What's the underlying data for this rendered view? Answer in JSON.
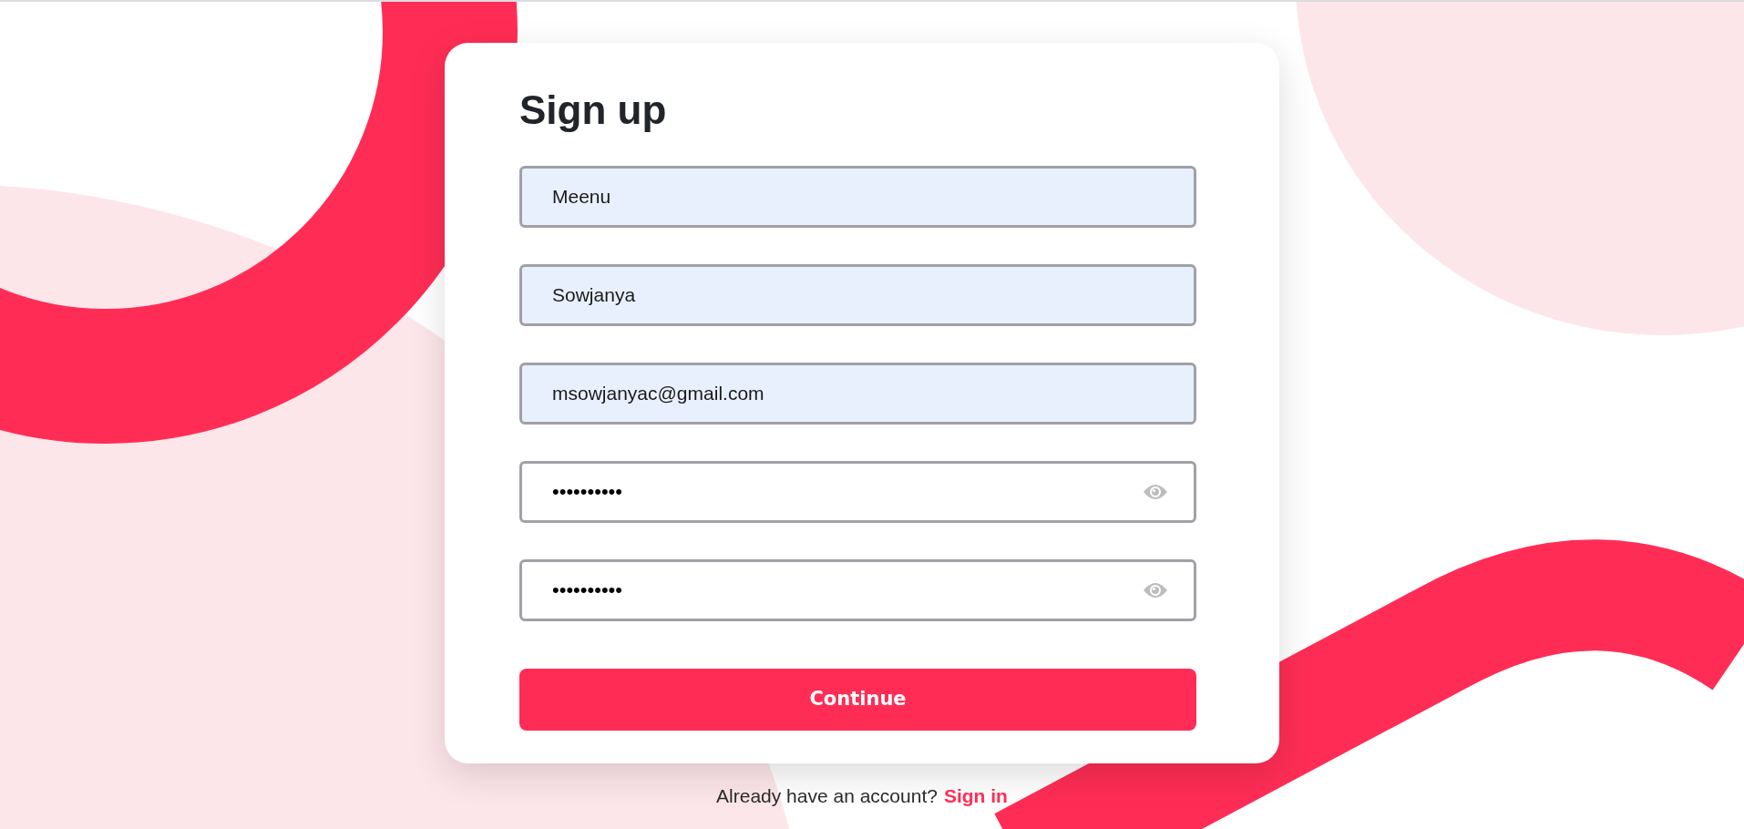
{
  "form": {
    "title": "Sign up",
    "fields": [
      {
        "kind": "text",
        "value": "Meenu",
        "autofilled": true
      },
      {
        "kind": "text",
        "value": "Sowjanya",
        "autofilled": true
      },
      {
        "kind": "text",
        "value": "msowjanyac@gmail.com",
        "autofilled": true
      },
      {
        "kind": "password",
        "value": "••••••••••",
        "autofilled": false
      },
      {
        "kind": "password",
        "value": "••••••••••",
        "autofilled": false
      }
    ],
    "submit": "Continue"
  },
  "footer": {
    "text": "Already have an account?",
    "link": "Sign in"
  }
}
